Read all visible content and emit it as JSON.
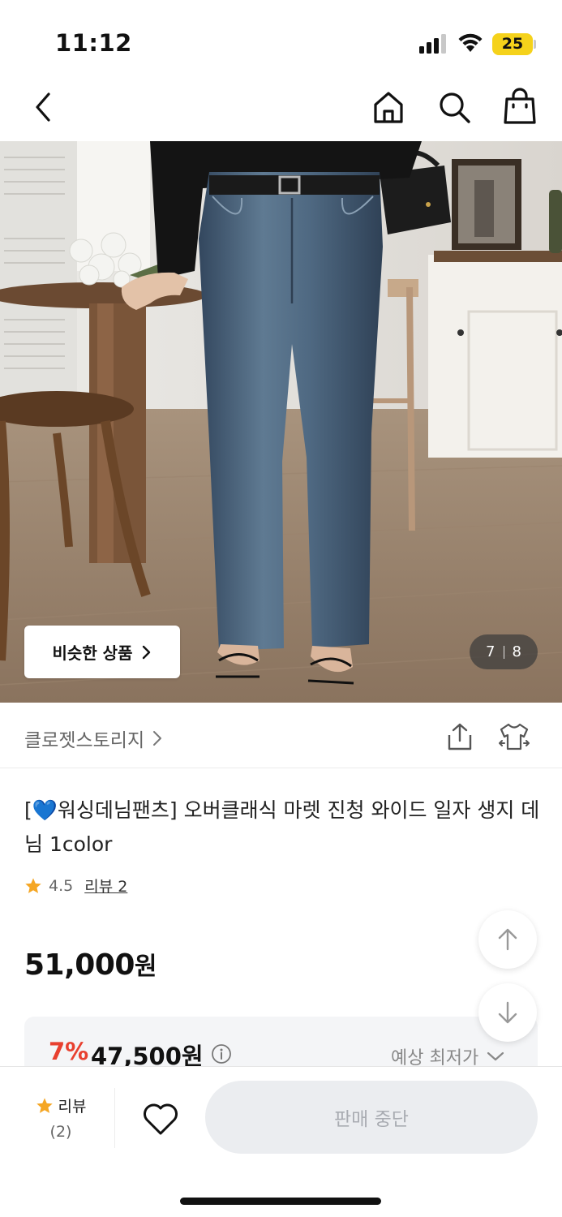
{
  "status_bar": {
    "time": "11:12",
    "battery": "25"
  },
  "nav": {
    "icons": [
      "back-icon",
      "home-icon",
      "search-icon",
      "shopping-bag-icon"
    ]
  },
  "gallery": {
    "similar_button_label": "비슷한 상품",
    "current_index": "7",
    "total": "8"
  },
  "brand": {
    "name": "클로젯스토리지"
  },
  "product": {
    "title_prefix": "[",
    "title_heart": "💙",
    "title_rest": "워싱데님팬츠] 오버클래식 마렛 진청 와이드 일자 생지 데님 1color",
    "rating": "4.5",
    "reviews_label": "리뷰 2",
    "price": "51,000",
    "price_unit": "원"
  },
  "lowest_price": {
    "discount": "7%",
    "price": "47,500원",
    "expected_label": "예상 최저가"
  },
  "bottom_bar": {
    "review_label": "리뷰",
    "review_count": "(2)",
    "action_label": "판매 중단"
  },
  "colors": {
    "discount_red": "#e8402f",
    "star": "#f5a623",
    "battery": "#f5d21b",
    "disabled_button_bg": "#ebedf0"
  }
}
